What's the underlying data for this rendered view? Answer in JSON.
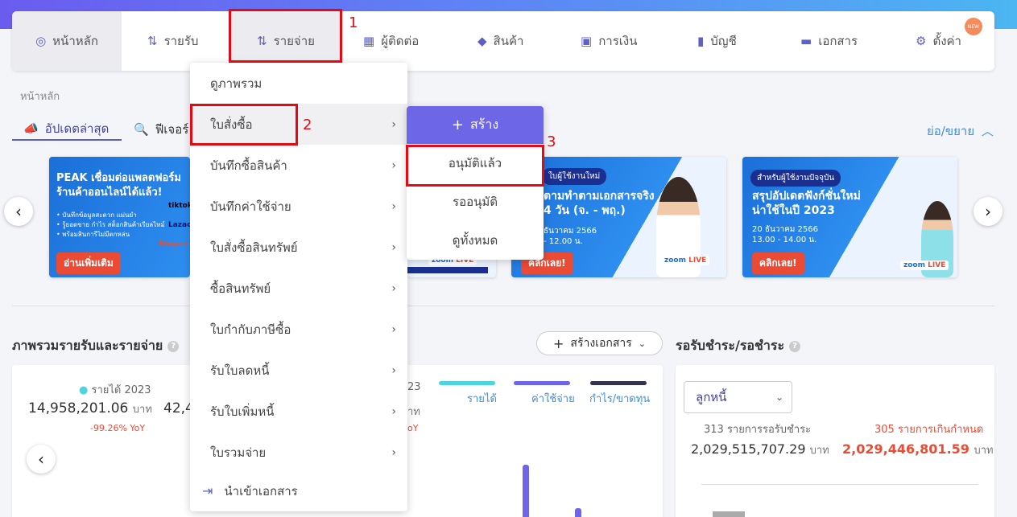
{
  "nav": {
    "home": "หน้าหลัก",
    "income": "รายรับ",
    "expense": "รายจ่าย",
    "contacts": "ผู้ติดต่อ",
    "products": "สินค้า",
    "finance": "การเงิน",
    "accounts": "บัญชี",
    "documents": "เอกสาร",
    "settings": "ตั้งค่า",
    "new_badge": "NEW"
  },
  "annotations": {
    "n1": "1",
    "n2": "2",
    "n3": "3"
  },
  "breadcrumb": "หน้าหลัก",
  "tabs": {
    "updates": "อัปเดตล่าสุด",
    "features": "ฟีเจอร์"
  },
  "collapse_label": "ย่อ/ขยาย",
  "banners": {
    "b1": {
      "title_line1": "PEAK เชื่อมต่อแพลตฟอร์ม",
      "title_line2": "ร้านค้าออนไลน์ได้แล้ว!",
      "bullet1": "• บันทึกข้อมูลสะดวก แม่นยำ",
      "bullet2": "• รู้ยอดขาย กำไร สต็อกสินค้าเรียลไทม์",
      "bullet3": "• พร้อมสินการีไม่มีตกหล่น",
      "cta": "อ่านเพิ่มเติม",
      "brand1": "tiktok",
      "brand2": "Lazada",
      "brand3": "Shopee"
    },
    "b3": {
      "tag": "ใบผู้ใช้งานใหม่",
      "title_line1": "ตามทำตามเอกสารจริง",
      "title_line2": "4 วัน (จ. - พฤ.)",
      "date": "ธันวาคม 2566",
      "time": "- 12.00 น.",
      "cta": "คลิกเลย!",
      "zoom": "zoom",
      "live": "LIVE"
    },
    "b4": {
      "tag": "สำหรับผู้ใช้งานปัจจุบัน",
      "title_line1": "สรุปอัปเดตฟังก์ชั่นใหม่",
      "title_line2": "น่าใช้ในปี 2023",
      "date": "20 ธันวาคม 2566",
      "time": "13.00 - 14.00 น.",
      "cta": "คลิกเลย!",
      "zoom": "zoom",
      "live": "LIVE"
    },
    "b2": {
      "zoom": "zoom",
      "live": "LIVE"
    }
  },
  "overview": {
    "title": "ภาพรวมรายรับและรายจ่าย",
    "create_doc": "สร้างเอกสาร",
    "income_label": "รายได้ 2023",
    "income_value": "14,958,201.06",
    "income_unit": "บาท",
    "income_yoy": "-99.26% YoY",
    "second_value": "42,4",
    "year_partial": "23",
    "unit_partial": "าท",
    "yoy_partial": "oY",
    "legend": {
      "income": "รายได้",
      "expense": "ค่าใช้จ่าย",
      "profit": "กำไร/ขาดทุน"
    }
  },
  "receivables": {
    "title": "รอรับชำระ/รอชำระ",
    "select_value": "ลูกหนี้",
    "count_pending": "313 รายการรอรับชำระ",
    "count_overdue": "305 รายการเกินกำหนด",
    "amount_pending": "2,029,515,707.29",
    "amount_overdue": "2,029,446,801.59",
    "unit": "บาท"
  },
  "dropdown": {
    "items": [
      {
        "label": "ดูภาพรวม"
      },
      {
        "label": "ใบสั่งซื้อ"
      },
      {
        "label": "บันทึกซื้อสินค้า"
      },
      {
        "label": "บันทึกค่าใช้จ่าย"
      },
      {
        "label": "ใบสั่งซื้อสินทรัพย์"
      },
      {
        "label": "ซื้อสินทรัพย์"
      },
      {
        "label": "ใบกำกับภาษีซื้อ"
      },
      {
        "label": "รับใบลดหนี้"
      },
      {
        "label": "รับใบเพิ่มหนี้"
      },
      {
        "label": "ใบรวมจ่าย"
      },
      {
        "label": "นำเข้าเอกสาร"
      }
    ]
  },
  "submenu": {
    "create": "สร้าง",
    "approved": "อนุมัติแล้ว",
    "pending": "รออนุมัติ",
    "all": "ดูทั้งหมด"
  },
  "colors": {
    "accent": "#5b5fc7",
    "annotation_red": "#e50914",
    "income_line": "#4dd4e0",
    "expense_line": "#6d66e6",
    "profit_line": "#2f3350",
    "overdue_red": "#e94b35"
  },
  "icons": {
    "home": "chart-circle-icon",
    "income": "sort-list-icon",
    "expense": "sort-list-icon",
    "contacts": "building-icon",
    "products": "box-icon",
    "finance": "money-icon",
    "accounts": "ledger-icon",
    "documents": "folder-icon",
    "settings": "gear-icon"
  }
}
